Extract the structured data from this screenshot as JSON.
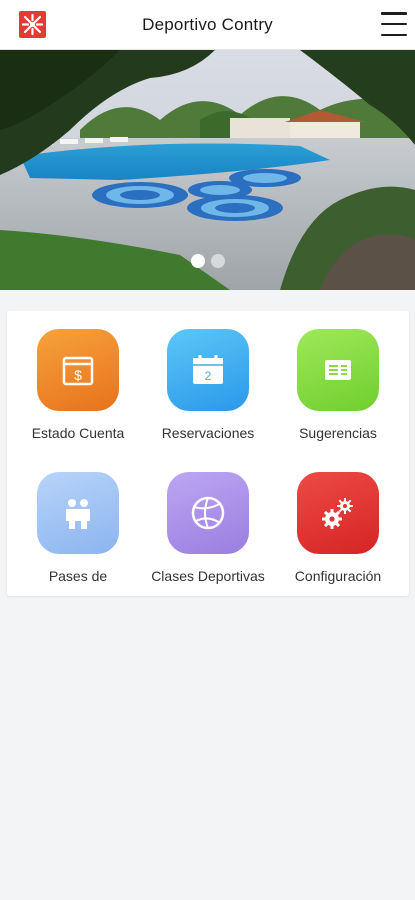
{
  "header": {
    "title": "Deportivo Contry",
    "logo_icon": "club-logo-icon",
    "menu_icon": "hamburger-menu-icon",
    "logo_color": "#e43b2f"
  },
  "carousel": {
    "slide_count": 2,
    "active_index": 0
  },
  "menu": {
    "items": [
      {
        "label": "Estado Cuenta",
        "icon": "dollar-calendar-icon",
        "color": "#f08a22"
      },
      {
        "label": "Reservaciones",
        "icon": "calendar-icon",
        "color": "#3aaef2"
      },
      {
        "label": "Sugerencias",
        "icon": "suggestion-note-icon",
        "color": "#8fd844"
      },
      {
        "label": "Pases de",
        "icon": "people-icon",
        "color": "#9ec2f5"
      },
      {
        "label": "Clases Deportivas",
        "icon": "volleyball-icon",
        "color": "#a98de8"
      },
      {
        "label": "Configuración",
        "icon": "gears-icon",
        "color": "#e23332"
      }
    ]
  }
}
